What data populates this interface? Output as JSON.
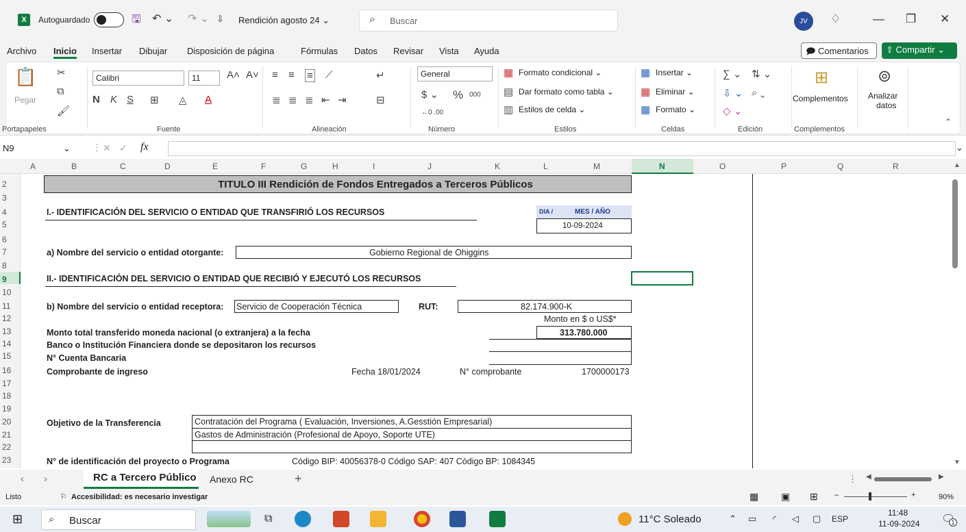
{
  "titlebar": {
    "app_icon": "X",
    "autosave_label": "Autoguardado",
    "filename": "Rendición agosto 24 ⌄",
    "search_placeholder": "Buscar",
    "avatar_initials": "JV"
  },
  "menu": {
    "items": [
      "Archivo",
      "Inicio",
      "Insertar",
      "Dibujar",
      "Disposición de página",
      "Fórmulas",
      "Datos",
      "Revisar",
      "Vista",
      "Ayuda"
    ],
    "active": "Inicio",
    "comments_label": "Comentarios",
    "share_label": "Compartir"
  },
  "ribbon": {
    "paste_label": "Pegar",
    "font_name": "Calibri",
    "font_size": "11",
    "number_format": "General",
    "groups": {
      "clipboard": "Portapapeles",
      "font": "Fuente",
      "alignment": "Alineación",
      "number": "Número",
      "styles": "Estilos",
      "cells": "Celdas",
      "editing": "Edición",
      "addins": "Complementos"
    },
    "styles_items": [
      "Formato condicional ⌄",
      "Dar formato como tabla ⌄",
      "Estilos de celda ⌄"
    ],
    "cells_items": [
      "Insertar ⌄",
      "Eliminar ⌄",
      "Formato ⌄"
    ],
    "addins_label": "Complementos",
    "analyze_label_1": "Analizar",
    "analyze_label_2": "datos"
  },
  "formula_bar": {
    "name_box": "N9",
    "fx": "fx",
    "content": ""
  },
  "columns": [
    "A",
    "B",
    "C",
    "D",
    "E",
    "F",
    "G",
    "H",
    "I",
    "J",
    "K",
    "L",
    "M",
    "N",
    "O",
    "P",
    "Q",
    "R"
  ],
  "rows": [
    "2",
    "3",
    "4",
    "5",
    "6",
    "7",
    "8",
    "9",
    "10",
    "11",
    "12",
    "13",
    "14",
    "15",
    "16",
    "17",
    "18",
    "19",
    "20",
    "21",
    "22",
    "23"
  ],
  "selected_cell": {
    "column": "N",
    "row": "9"
  },
  "sheet": {
    "title": "TITULO III   Rendición de Fondos Entregados a Terceros Públicos",
    "section1": "I.-  IDENTIFICACIÓN DEL SERVICIO O ENTIDAD QUE TRANSFIRIÓ LOS RECURSOS",
    "date_hdr_day": "DIA /",
    "date_hdr_rest": "MES  /  AÑO",
    "date_value": "10-09-2024",
    "label_a": "a) Nombre del servicio o entidad otorgante:",
    "value_a": "Gobierno Regional de Ohiggins",
    "section2": "II.-  IDENTIFICACIÓN DEL SERVICIO O ENTIDAD QUE RECIBIÓ Y EJECUTÓ LOS RECURSOS",
    "label_b": "b) Nombre del servicio o entidad receptora:",
    "value_b": "Servicio de Cooperación Técnica",
    "rut_label": "RUT:",
    "rut_value": "82.174.900-K",
    "monto_hdr": "Monto en $ o US$*",
    "monto_label": "Monto total transferido moneda nacional (o extranjera) a la fecha",
    "monto_value": "313.780.000",
    "banco_label": "Banco o Institución Financiera donde se depositaron los recursos",
    "cuenta_label": "N° Cuenta Bancaria",
    "comprobante_label": "Comprobante de ingreso",
    "fecha_text": "Fecha 18/01/2024",
    "ncomp_label": "N° comprobante",
    "ncomp_value": "1700000173",
    "objetivo_label": "Objetivo de la Transferencia",
    "objetivo_1": "Contratación del Programa ( Evaluación, Inversiones, A.Gesstión Empresarial)",
    "objetivo_2": "Gastos de Administración (Profesional de Apoyo, Soporte UTE)",
    "proyecto_label": "N° de identificación del proyecto o Programa",
    "proyecto_value": "Código BIP: 40056378-0  Código SAP: 407   Código BP: 1084345"
  },
  "tabs": {
    "active": "RC a Tercero Público",
    "other": "Anexo RC",
    "add": "+"
  },
  "status": {
    "ready": "Listo",
    "accessibility": "Accesibilidad: es necesario investigar",
    "zoom": "90%"
  },
  "taskbar": {
    "search": "Buscar",
    "weather": "11°C  Soleado",
    "lang": "ESP",
    "time": "11:48",
    "date": "11-09-2024",
    "notifications": "1"
  }
}
